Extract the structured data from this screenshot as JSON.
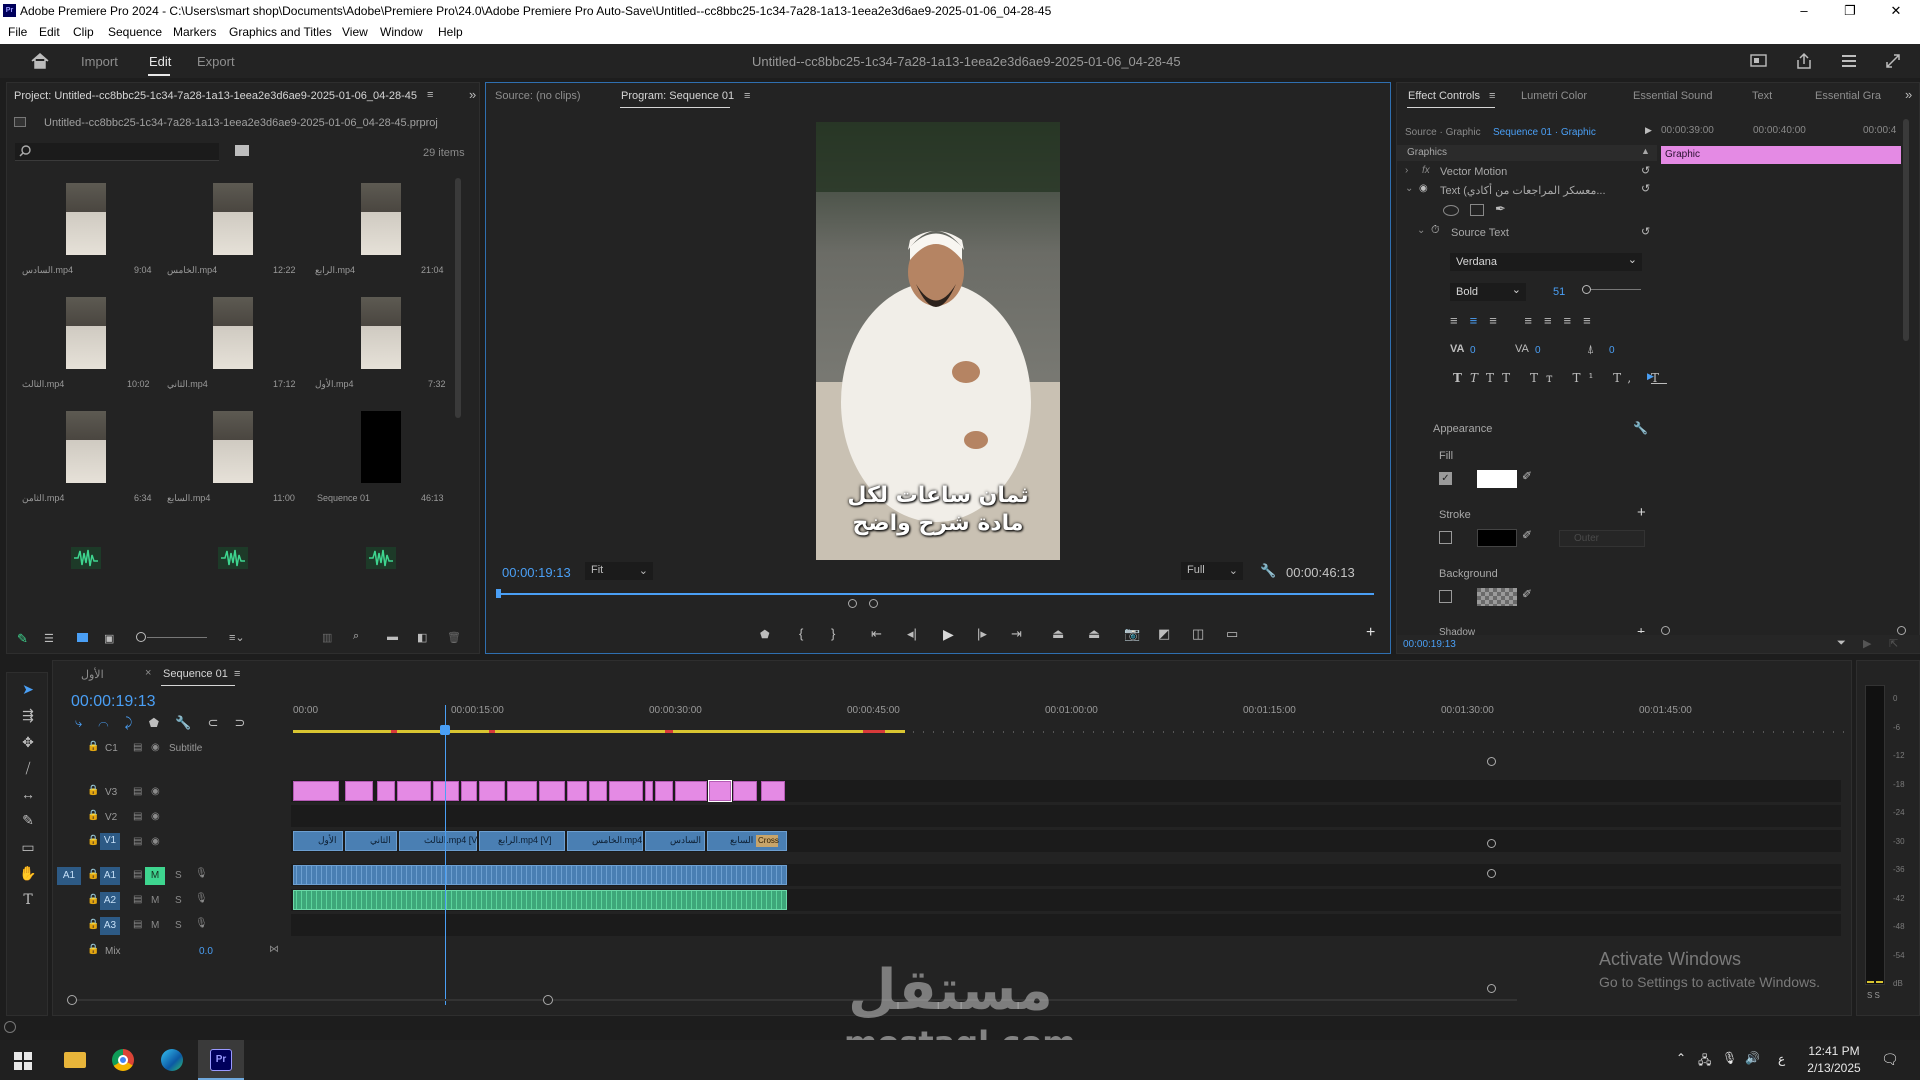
{
  "window": {
    "title": "Adobe Premiere Pro 2024 - C:\\Users\\smart shop\\Documents\\Adobe\\Premiere Pro\\24.0\\Adobe Premiere Pro Auto-Save\\Untitled--cc8bbc25-1c34-7a28-1a13-1eea2e3d6ae9-2025-01-06_04-28-45",
    "app_badge": "Pr",
    "minimize": "–",
    "maximize": "❐",
    "close": "✕"
  },
  "menu": [
    "File",
    "Edit",
    "Clip",
    "Sequence",
    "Markers",
    "Graphics and Titles",
    "View",
    "Window",
    "Help"
  ],
  "header": {
    "tabs": [
      "Import",
      "Edit",
      "Export"
    ],
    "active_tab": "Edit",
    "project_title": "Untitled--cc8bbc25-1c34-7a28-1a13-1eea2e3d6ae9-2025-01-06_04-28-45"
  },
  "project": {
    "tab": "Project: Untitled--cc8bbc25-1c34-7a28-1a13-1eea2e3d6ae9-2025-01-06_04-28-45",
    "file": "Untitled--cc8bbc25-1c34-7a28-1a13-1eea2e3d6ae9-2025-01-06_04-28-45.prproj",
    "items_count": "29 items",
    "items": [
      {
        "name": "السادس.mp4",
        "dur": "9:04"
      },
      {
        "name": "الخامس.mp4",
        "dur": "12:22"
      },
      {
        "name": "الرابع.mp4",
        "dur": "21:04"
      },
      {
        "name": "الثالث.mp4",
        "dur": "10:02"
      },
      {
        "name": "الثاني.mp4",
        "dur": "17:12"
      },
      {
        "name": "الأول.mp4",
        "dur": "7:32"
      },
      {
        "name": "الثامن.mp4",
        "dur": "6:34"
      },
      {
        "name": "السابع.mp4",
        "dur": "11:00"
      },
      {
        "name": "Sequence 01",
        "dur": "46:13"
      }
    ]
  },
  "monitor": {
    "source_tab": "Source: (no clips)",
    "program_tab": "Program: Sequence 01",
    "timecode": "00:00:19:13",
    "fit": "Fit",
    "quality": "Full",
    "duration": "00:00:46:13",
    "caption_line1": "ثمان ساعات لكل",
    "caption_line2": "مادة شرح واضح"
  },
  "effects": {
    "tabs": [
      "Effect Controls",
      "Lumetri Color",
      "Essential Sound",
      "Text",
      "Essential Gra"
    ],
    "source_label": "Source · Graphic",
    "sequence_label": "Sequence 01 · Graphic",
    "time1": "00:00:39:00",
    "time2": "00:00:40:00",
    "time3": "00:00:4",
    "graphic_bar": "Graphic",
    "section": "Graphics",
    "vector_motion": "Vector Motion",
    "text_layer": "Text (معسكر المراجعات من أكادي...",
    "source_text": "Source Text",
    "font": "Verdana",
    "style": "Bold",
    "size": "51",
    "tracking": "0",
    "kerning": "0",
    "baseline": "0",
    "appearance": "Appearance",
    "fill": "Fill",
    "stroke": "Stroke",
    "stroke_type": "Outer",
    "background": "Background",
    "shadow": "Shadow",
    "timecode": "00:00:19:13",
    "fill_color": "#ffffff",
    "stroke_color": "#000000"
  },
  "timeline": {
    "tab_inactive": "الأول",
    "tab_active": "Sequence 01",
    "timecode": "00:00:19:13",
    "ruler": [
      "00:00",
      "00:00:15:00",
      "00:00:30:00",
      "00:00:45:00",
      "00:01:00:00",
      "00:01:15:00",
      "00:01:30:00",
      "00:01:45:00"
    ],
    "subtitle_label": "Subtitle",
    "c1": "C1",
    "tracks_video": [
      "V3",
      "V2",
      "V1"
    ],
    "tracks_audio": [
      "A1",
      "A2",
      "A3"
    ],
    "src_patch": "A1",
    "mix_label": "Mix",
    "mix_value": "0.0",
    "m": "M",
    "s": "S",
    "v1_clips": [
      "الأول",
      "الثاني",
      "الثالث.mp4 [V]",
      "الرابع.mp4 [V]",
      "الخامس.mp4 [",
      "السادس",
      "السابع"
    ],
    "cross": "Cross",
    "meter_labels": [
      "0",
      "-6",
      "-12",
      "-18",
      "-24",
      "-30",
      "-36",
      "-42",
      "-48",
      "-54",
      "dB"
    ],
    "meter_ss": "S S"
  },
  "watermark": {
    "activate_title": "Activate Windows",
    "activate_sub": "Go to Settings to activate Windows.",
    "brand": "مستقل",
    "brand_url": "mostaql.com"
  },
  "taskbar": {
    "time": "12:41 PM",
    "date": "2/13/2025",
    "lang": "ع",
    "pr": "Pr"
  }
}
